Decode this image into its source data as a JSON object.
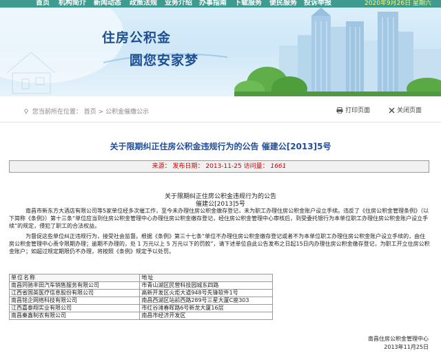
{
  "nav": {
    "items": [
      "首页",
      "机构简介",
      "新闻动态",
      "政策法规",
      "业务介绍",
      "办事指南",
      "下载服务",
      "便民服务",
      "投诉举报"
    ],
    "date": "2020年9月26日 星期六"
  },
  "banner": {
    "title1": "住房公积金",
    "title2": "圆您安家梦"
  },
  "breadcrumb": {
    "prefix": "您当前所在位置：",
    "home": "首页",
    "separator": ">",
    "section": "公积金催缴公示"
  },
  "tools": {
    "print": "打印页面",
    "close": "关闭页面"
  },
  "article": {
    "title": "关于限期纠正住房公积金违规行为的公告 催建公[2013]5号",
    "source_label": "来源：",
    "date_label": "发布日期：",
    "date": "2013-11-25",
    "visits_label": "访问量：",
    "visits": "1661",
    "heading": "关于限期纠正住房公积金违规行为的公告",
    "doc_number": "催建公[2013]5号",
    "para1": "南昌市新东方大酒店有限公司等5家单位经多次催工作，至今未办理住房公积金缴存登记，未为职工办理住房公积金账户设立手续。违反了《住房公积金管理条例》（以下简称《条例》）第十三条“单位应当到住房公积金管理中心办理住房公积金缴存登记，经住房公积金管理中心审核后，到受委托银行为本单位职工办理住房公积金账户设立手续”的规定，侵犯了职工的合法权益。",
    "para2": "为督促这些单位纠正违规行为，接受社会监督。根据《条例》第三十七条“单位不办理住房公积金缴存登记或者不为本单位职工办理住房公积金账户设立手续的，由住房公积金管理中心责令限期办理；逾期不办理的，处 1 万元以上 5 万元以下的罚款”，请下述单位自此公告发布之日起15日内办理住房公积金缴存登记，为职工开立住房公积金账户；如超过规定期限仍不办理，将按照《条例》规定予以处罚。",
    "table": {
      "headers": [
        "单位名称",
        "地址"
      ],
      "rows": [
        [
          "南昌同驰丰田汽车销售服务有限公司",
          "市青山湖区民营科技园城东四路"
        ],
        [
          "江西省国英医疗信息股份有限公司",
          "高新开发区火炬大道948号先锋软件1号"
        ],
        [
          "南昌铭企网络科技有限公司",
          "南昌西湖区站前西路289号三星大厦C座303"
        ],
        [
          "江西嘉泰翔实业有限公司",
          "市红谷滩春晖路6号新龙大厦16层"
        ],
        [
          "南昌秦鑫制衣有限公司",
          "南昌市经济开发区"
        ]
      ]
    },
    "signature": "南昌住房公积金管理中心",
    "sign_date": "2013年11月25日"
  },
  "colors": {
    "nav_bg": "#3f9a8f",
    "nav_date": "#ffff66",
    "banner_title": "#1d4f93",
    "article_title": "#1f4d9c",
    "info_text": "#cc0000"
  }
}
